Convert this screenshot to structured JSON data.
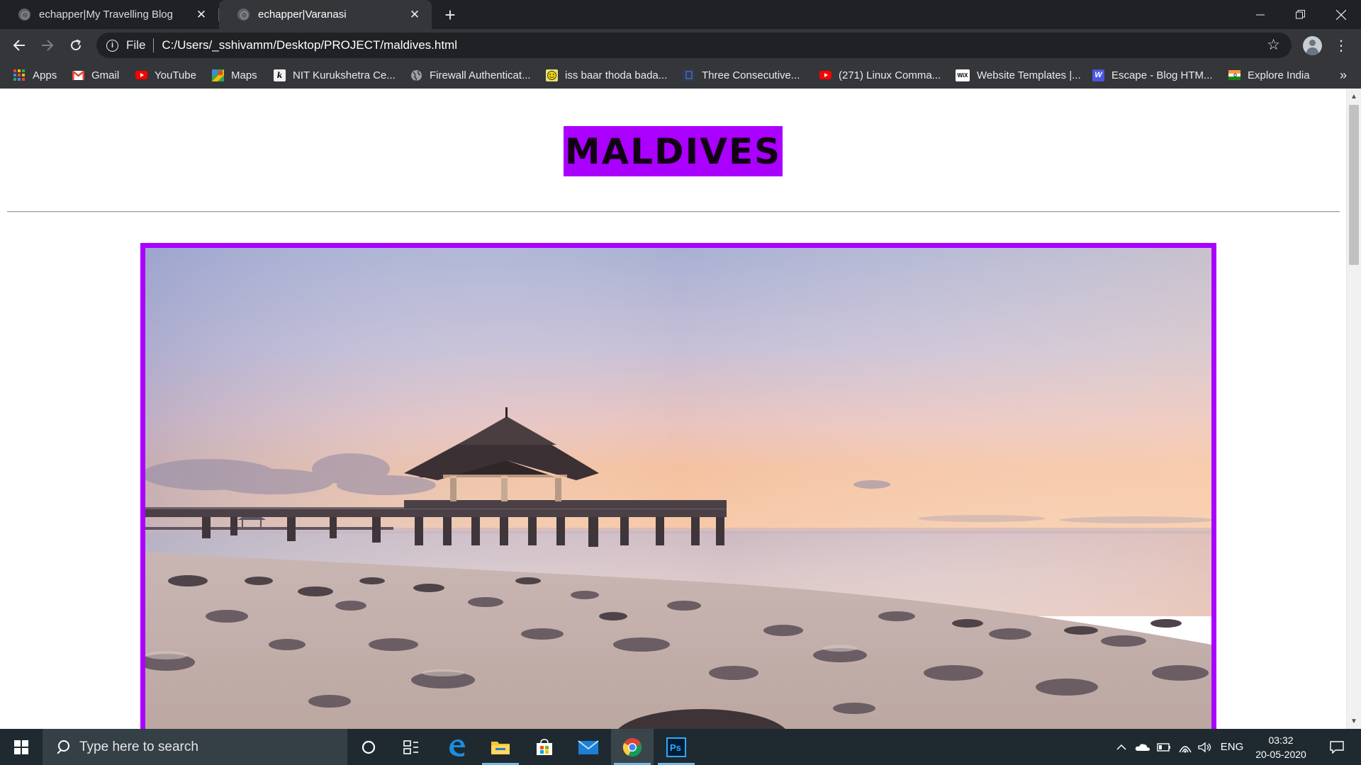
{
  "browser": {
    "tabs": [
      {
        "title": "echapper|My Travelling Blog",
        "active": false
      },
      {
        "title": "echapper|Varanasi",
        "active": true
      }
    ],
    "address": {
      "scheme_label": "File",
      "url": "C:/Users/_sshivamm/Desktop/PROJECT/maldives.html"
    },
    "bookmarks": [
      {
        "label": "Apps",
        "icon": "apps-grid-icon"
      },
      {
        "label": "Gmail",
        "icon": "gmail-icon"
      },
      {
        "label": "YouTube",
        "icon": "youtube-icon"
      },
      {
        "label": "Maps",
        "icon": "maps-icon"
      },
      {
        "label": "NIT Kurukshetra Ce...",
        "icon": "nit-kurukshetra-icon"
      },
      {
        "label": "Firewall Authenticat...",
        "icon": "globe-icon"
      },
      {
        "label": "iss baar thoda bada...",
        "icon": "smiley-icon"
      },
      {
        "label": "Three Consecutive...",
        "icon": "bookmark-page-icon"
      },
      {
        "label": "(271) Linux Comma...",
        "icon": "youtube-icon"
      },
      {
        "label": "Website Templates |...",
        "icon": "wix-icon"
      },
      {
        "label": "Escape - Blog HTM...",
        "icon": "w-icon"
      },
      {
        "label": "Explore India",
        "icon": "india-flag-icon"
      }
    ]
  },
  "page": {
    "heading": "MALDIVES",
    "accent_color": "#aa00ff"
  },
  "taskbar": {
    "search_placeholder": "Type here to search",
    "apps": [
      "cortana-icon",
      "task-view-icon",
      "edge-icon",
      "file-explorer-icon",
      "store-icon",
      "mail-icon",
      "chrome-icon",
      "photoshop-icon"
    ],
    "language": "ENG",
    "time": "03:32",
    "date": "20-05-2020"
  }
}
